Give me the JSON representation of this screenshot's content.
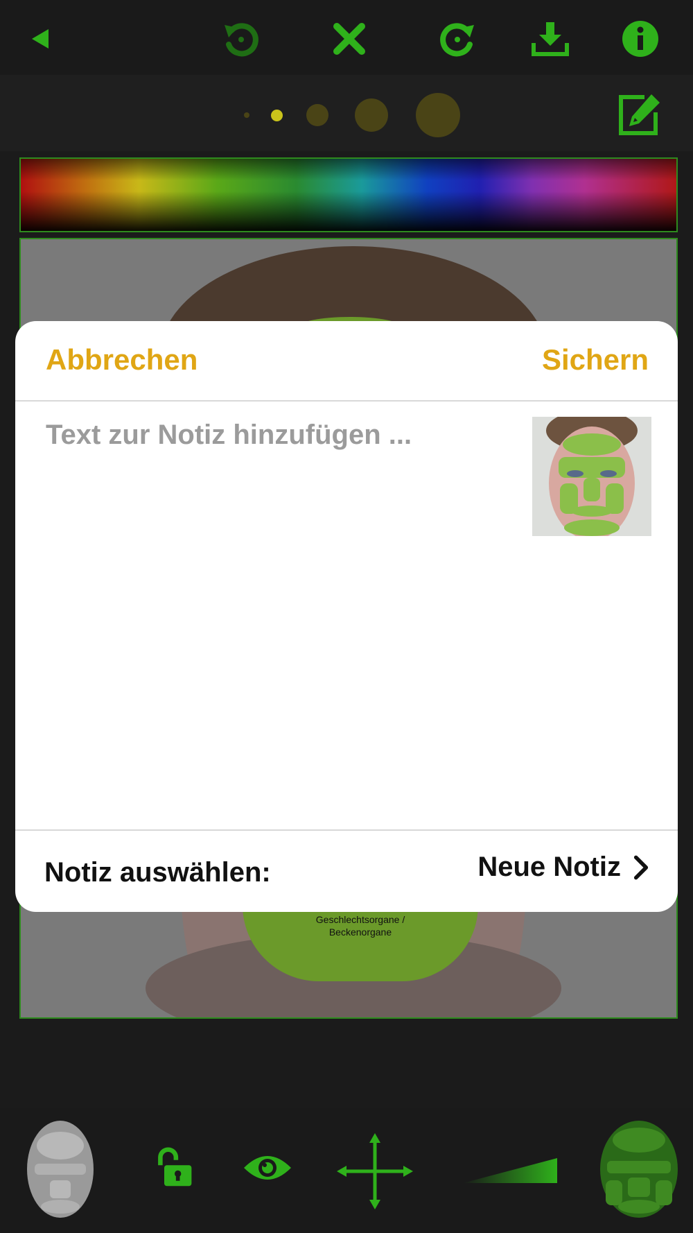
{
  "colors": {
    "accent_green": "#2fb11b",
    "dim_green": "#1f6e14",
    "modal_button": "#e0a615",
    "dot_active": "#c9c31b",
    "dot_inactive": "#4a4416"
  },
  "toolbar": {
    "icons": [
      "back-icon",
      "undo-icon",
      "close-icon",
      "redo-icon",
      "download-icon",
      "info-icon"
    ]
  },
  "brush_sizes": {
    "selected_index": 1,
    "count": 5
  },
  "photo": {
    "zone_label": "Geschlechtsorgane /\nBeckenorgane"
  },
  "modal": {
    "cancel_label": "Abbrechen",
    "save_label": "Sichern",
    "note_placeholder": "Text zur Notiz hinzufügen ...",
    "note_value": "",
    "select_label": "Notiz auswählen:",
    "select_value": "Neue Notiz"
  },
  "bottom_toolbar": {
    "icons": [
      "face-map-gray-icon",
      "unlock-icon",
      "eye-icon",
      "move-arrows-icon",
      "opacity-slider-icon",
      "face-map-green-icon"
    ]
  }
}
